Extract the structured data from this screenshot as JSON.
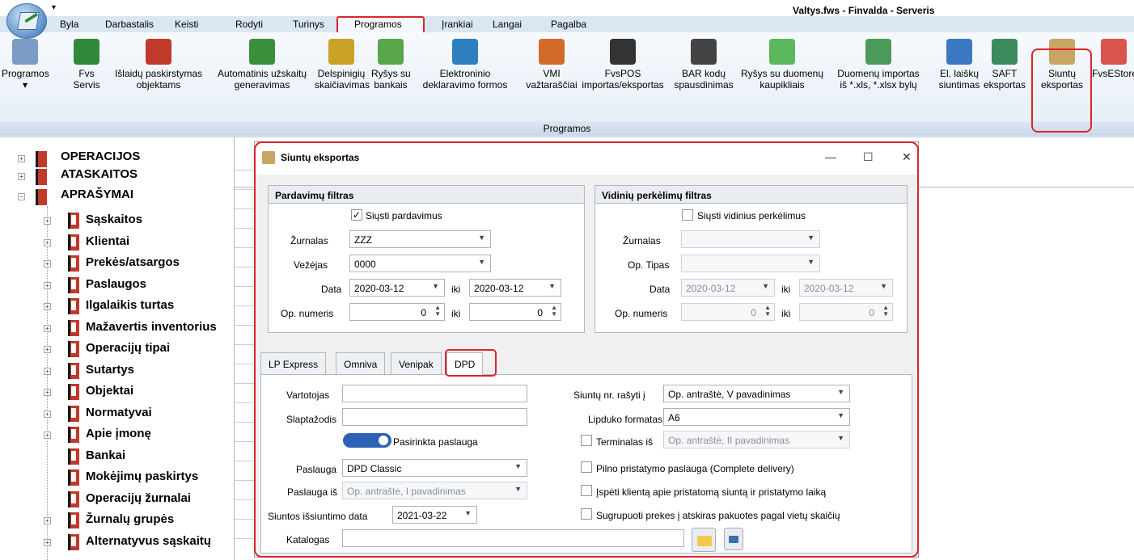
{
  "window": {
    "title": "Valtys.fws - Finvalda - Serveris"
  },
  "menu": [
    "Byla",
    "Darbastalis",
    "Keisti",
    "Rodyti",
    "Turinys",
    "Programos",
    "Įrankiai",
    "Langai",
    "Pagalba"
  ],
  "ribbon": {
    "buttons": [
      {
        "l1": "Programos",
        "l2": "▾",
        "icon": "calculator-icon"
      },
      {
        "l1": "Fvs",
        "l2": "Servis",
        "icon": "fvs-servis-icon"
      },
      {
        "l1": "Išlaidų paskirstymas",
        "l2": "objektams",
        "icon": "distribution-icon"
      },
      {
        "l1": "Automatinis užskaitų",
        "l2": "generavimas",
        "icon": "auto-offset-icon"
      },
      {
        "l1": "Delspinigių",
        "l2": "skaičiavimas",
        "icon": "abacus-icon"
      },
      {
        "l1": "Ryšys su",
        "l2": "bankais",
        "icon": "bank-link-icon"
      },
      {
        "l1": "Elektroninio",
        "l2": "deklaravimo formos",
        "icon": "globe-edit-icon"
      },
      {
        "l1": "VMI",
        "l2": "važtaraščiai",
        "icon": "truck-icon"
      },
      {
        "l1": "FvsPOS",
        "l2": "importas/eksportas",
        "icon": "pos-icon"
      },
      {
        "l1": "BAR kodų",
        "l2": "spausdinimas",
        "icon": "barcode-icon"
      },
      {
        "l1": "Ryšys su duomenų",
        "l2": "kaupikliais",
        "icon": "data-collector-icon"
      },
      {
        "l1": "Duomenų importas",
        "l2": "iš *.xls, *.xlsx bylų",
        "icon": "excel-import-icon"
      },
      {
        "l1": "El. laiškų",
        "l2": "siuntimas",
        "icon": "email-icon"
      },
      {
        "l1": "SAFT",
        "l2": "eksportas",
        "icon": "saft-icon"
      },
      {
        "l1": "Siuntų",
        "l2": "eksportas",
        "icon": "package-icon"
      },
      {
        "l1": "FvsEStore",
        "l2": "",
        "icon": "store-icon"
      }
    ],
    "group_label": "Programos"
  },
  "tree": {
    "top": [
      "OPERACIJOS",
      "ATASKAITOS",
      "APRAŠYMAI"
    ],
    "children": [
      "Sąskaitos",
      "Klientai",
      "Prekės/atsargos",
      "Paslaugos",
      "Ilgalaikis turtas",
      "Mažavertis inventorius",
      "Operacijų tipai",
      "Sutartys",
      "Objektai",
      "Normatyvai",
      "Apie įmonę",
      "Bankai",
      "Mokėjimų paskirtys",
      "Operacijų žurnalai",
      "Žurnalų grupės",
      "Alternatyvus sąskaitų"
    ]
  },
  "dialog": {
    "title": "Siuntų eksportas",
    "minimize": "—",
    "maximize": "☐",
    "close": "✕",
    "sales": {
      "header": "Pardavimų filtras",
      "send_label": "Siųsti pardavimus",
      "send_checked": true,
      "journal_label": "Žurnalas",
      "journal_value": "ZZZ",
      "carrier_label": "Vežėjas",
      "carrier_value": "0000",
      "date_label": "Data",
      "date_from": "2020-03-12",
      "date_to": "2020-03-12",
      "to_label": "iki",
      "opnum_label": "Op. numeris",
      "opnum_from": "0",
      "opnum_to": "0"
    },
    "internal": {
      "header": "Vidinių perkėlimų filtras",
      "send_label": "Siųsti vidinius perkėlimus",
      "send_checked": false,
      "journal_label": "Žurnalas",
      "journal_value": "",
      "optype_label": "Op. Tipas",
      "optype_value": "",
      "date_label": "Data",
      "date_from": "2020-03-12",
      "date_to": "2020-03-12",
      "to_label": "iki",
      "opnum_label": "Op. numeris",
      "opnum_from": "0",
      "opnum_to": "0"
    },
    "tabs": [
      "LP Express",
      "Omniva",
      "Venipak",
      "DPD"
    ],
    "active_tab": "DPD",
    "dpd": {
      "user_label": "Vartotojas",
      "user_value": "",
      "password_label": "Slaptažodis",
      "password_value": "",
      "toggle_label": "Pasirinkta paslauga",
      "service_label": "Paslauga",
      "service_value": "DPD Classic",
      "service_from_label": "Paslauga iš",
      "service_from_value": "Op. antraštė, I pavadinimas",
      "ship_date_label": "Siuntos išsiuntimo data",
      "ship_date_value": "2021-03-22",
      "catalog_label": "Katalogas",
      "catalog_value": "",
      "write_nr_label": "Siuntų nr. rašyti į",
      "write_nr_value": "Op. antraštė, V pavadinimas",
      "label_format_label": "Lipduko formatas",
      "label_format_value": "A6",
      "terminal_label": "Terminalas iš",
      "terminal_value": "Op. antraštė, II pavadinimas",
      "complete_label": "Pilno pristatymo paslauga (Complete delivery)",
      "notify_label": "Įspėti klientą apie pristatomą siuntą ir pristatymo laiką",
      "group_label": "Sugrupuoti prekes į atskiras pakuotes pagal vietų skaičių"
    }
  }
}
